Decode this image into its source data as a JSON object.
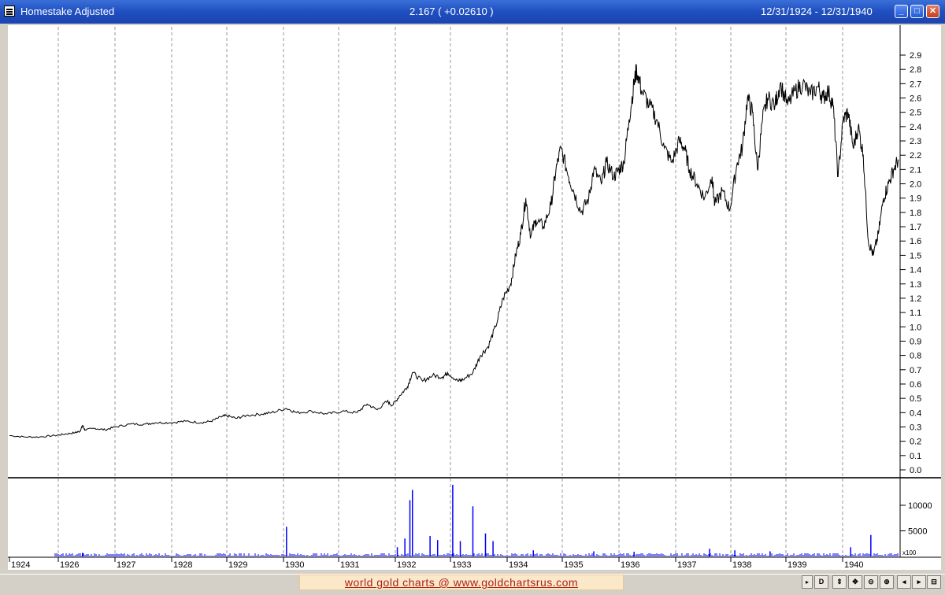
{
  "window": {
    "title": "Homestake Adjusted",
    "last_value": "2.167 ( +0.02610 )",
    "date_range": "12/31/1924 - 12/31/1940",
    "minimize_label": "_",
    "maximize_label": "□",
    "close_label": "✕"
  },
  "footer": {
    "watermark": "world gold charts @ www.goldchartsrus.com",
    "buttons": [
      "D",
      "⇕",
      "✥",
      "⊝",
      "⊕",
      "◂",
      "▸",
      "⊟"
    ],
    "scroll_label": "▸"
  },
  "colors": {
    "price_line": "#000000",
    "volume_bars": "#0000ff",
    "background": "#ffffff",
    "frame": "#d4d0c8"
  },
  "chart_data": [
    {
      "type": "line",
      "name": "price",
      "ylim": [
        0.0,
        2.9
      ],
      "yticks": [
        "0.0",
        "0.1",
        "0.2",
        "0.3",
        "0.4",
        "0.5",
        "0.6",
        "0.7",
        "0.8",
        "0.9",
        "1.0",
        "1.1",
        "1.2",
        "1.3",
        "1.4",
        "1.5",
        "1.6",
        "1.7",
        "1.8",
        "1.9",
        "2.0",
        "2.1",
        "2.2",
        "2.3",
        "2.4",
        "2.5",
        "2.6",
        "2.7",
        "2.8",
        "2.9"
      ],
      "x_years": [
        1924,
        1926,
        1927,
        1928,
        1929,
        1930,
        1931,
        1932,
        1933,
        1934,
        1935,
        1936,
        1937,
        1938,
        1939,
        1940
      ],
      "x_range": [
        1924.0,
        1940.95
      ],
      "grid": "vertical dashed at year marks",
      "points": [
        [
          1924.0,
          0.24
        ],
        [
          1924.3,
          0.23
        ],
        [
          1924.6,
          0.23
        ],
        [
          1924.9,
          0.24
        ],
        [
          1925.1,
          0.25
        ],
        [
          1925.3,
          0.26
        ],
        [
          1925.4,
          0.27
        ],
        [
          1925.45,
          0.31
        ],
        [
          1925.5,
          0.28
        ],
        [
          1925.7,
          0.29
        ],
        [
          1925.9,
          0.28
        ],
        [
          1926.1,
          0.3
        ],
        [
          1926.4,
          0.32
        ],
        [
          1926.7,
          0.32
        ],
        [
          1926.9,
          0.33
        ],
        [
          1927.2,
          0.33
        ],
        [
          1927.5,
          0.34
        ],
        [
          1927.8,
          0.33
        ],
        [
          1928.0,
          0.34
        ],
        [
          1928.2,
          0.37
        ],
        [
          1928.3,
          0.38
        ],
        [
          1928.5,
          0.36
        ],
        [
          1928.7,
          0.38
        ],
        [
          1929.0,
          0.39
        ],
        [
          1929.2,
          0.4
        ],
        [
          1929.5,
          0.43
        ],
        [
          1929.7,
          0.4
        ],
        [
          1930.0,
          0.41
        ],
        [
          1930.3,
          0.39
        ],
        [
          1930.6,
          0.41
        ],
        [
          1930.9,
          0.4
        ],
        [
          1931.1,
          0.46
        ],
        [
          1931.3,
          0.42
        ],
        [
          1931.5,
          0.48
        ],
        [
          1931.6,
          0.45
        ],
        [
          1931.75,
          0.52
        ],
        [
          1931.9,
          0.58
        ],
        [
          1932.0,
          0.68
        ],
        [
          1932.2,
          0.62
        ],
        [
          1932.4,
          0.66
        ],
        [
          1932.6,
          0.65
        ],
        [
          1932.7,
          0.68
        ],
        [
          1932.9,
          0.62
        ],
        [
          1933.0,
          0.63
        ],
        [
          1933.2,
          0.68
        ],
        [
          1933.35,
          0.8
        ],
        [
          1933.5,
          0.86
        ],
        [
          1933.65,
          1.0
        ],
        [
          1933.8,
          1.2
        ],
        [
          1933.95,
          1.3
        ],
        [
          1934.05,
          1.5
        ],
        [
          1934.15,
          1.65
        ],
        [
          1934.25,
          1.9
        ],
        [
          1934.35,
          1.63
        ],
        [
          1934.45,
          1.75
        ],
        [
          1934.6,
          1.7
        ],
        [
          1934.75,
          1.85
        ],
        [
          1934.85,
          2.1
        ],
        [
          1934.95,
          2.25
        ],
        [
          1935.1,
          2.05
        ],
        [
          1935.2,
          1.95
        ],
        [
          1935.35,
          1.8
        ],
        [
          1935.5,
          1.9
        ],
        [
          1935.6,
          2.1
        ],
        [
          1935.75,
          2.0
        ],
        [
          1935.85,
          2.15
        ],
        [
          1936.0,
          2.05
        ],
        [
          1936.1,
          2.1
        ],
        [
          1936.2,
          2.15
        ],
        [
          1936.3,
          2.45
        ],
        [
          1936.4,
          2.7
        ],
        [
          1936.45,
          2.8
        ],
        [
          1936.55,
          2.65
        ],
        [
          1936.7,
          2.55
        ],
        [
          1936.85,
          2.45
        ],
        [
          1937.0,
          2.25
        ],
        [
          1937.15,
          2.15
        ],
        [
          1937.3,
          2.3
        ],
        [
          1937.4,
          2.25
        ],
        [
          1937.5,
          2.1
        ],
        [
          1937.65,
          2.0
        ],
        [
          1937.8,
          1.9
        ],
        [
          1937.95,
          2.05
        ],
        [
          1938.0,
          1.85
        ],
        [
          1938.15,
          1.95
        ],
        [
          1938.3,
          1.82
        ],
        [
          1938.45,
          2.15
        ],
        [
          1938.55,
          2.25
        ],
        [
          1938.65,
          2.6
        ],
        [
          1938.75,
          2.5
        ],
        [
          1938.85,
          2.1
        ],
        [
          1938.95,
          2.45
        ],
        [
          1939.05,
          2.6
        ],
        [
          1939.2,
          2.55
        ],
        [
          1939.3,
          2.7
        ],
        [
          1939.45,
          2.55
        ],
        [
          1939.6,
          2.65
        ],
        [
          1939.75,
          2.7
        ],
        [
          1939.9,
          2.62
        ],
        [
          1940.05,
          2.68
        ],
        [
          1940.15,
          2.6
        ],
        [
          1940.25,
          2.65
        ],
        [
          1940.35,
          2.55
        ],
        [
          1940.45,
          2.05
        ],
        [
          1940.55,
          2.45
        ],
        [
          1940.65,
          2.5
        ],
        [
          1940.75,
          2.25
        ],
        [
          1940.85,
          2.4
        ],
        [
          1940.95,
          2.2
        ],
        [
          1941.05,
          1.6
        ],
        [
          1941.15,
          1.5
        ],
        [
          1941.25,
          1.65
        ],
        [
          1941.35,
          1.9
        ],
        [
          1941.45,
          2.0
        ],
        [
          1941.55,
          2.1
        ],
        [
          1941.65,
          2.17
        ]
      ]
    },
    {
      "type": "bar",
      "name": "volume",
      "unit_label": "x100",
      "ylim": [
        0,
        14000
      ],
      "yticks": [
        "5000",
        "10000"
      ],
      "bars": [
        [
          1925.45,
          700
        ],
        [
          1929.5,
          5800
        ],
        [
          1931.7,
          1800
        ],
        [
          1931.85,
          3500
        ],
        [
          1931.95,
          11000
        ],
        [
          1932.0,
          13000
        ],
        [
          1932.35,
          4000
        ],
        [
          1932.5,
          3200
        ],
        [
          1932.8,
          14000
        ],
        [
          1932.95,
          3000
        ],
        [
          1933.2,
          9800
        ],
        [
          1933.45,
          4500
        ],
        [
          1933.6,
          3000
        ],
        [
          1934.4,
          1200
        ],
        [
          1935.6,
          1000
        ],
        [
          1936.4,
          900
        ],
        [
          1937.9,
          1500
        ],
        [
          1938.4,
          1200
        ],
        [
          1939.1,
          1000
        ],
        [
          1940.7,
          1800
        ],
        [
          1941.1,
          4200
        ]
      ]
    }
  ]
}
